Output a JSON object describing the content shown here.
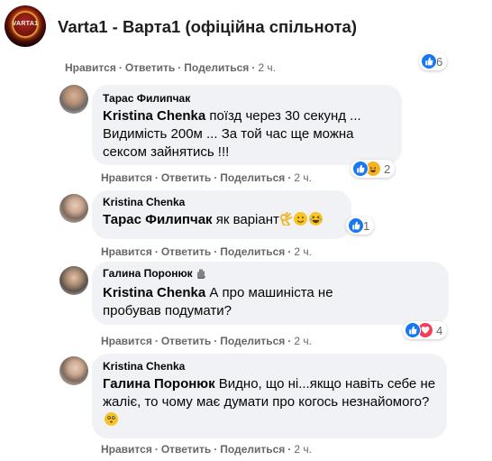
{
  "group": {
    "logo_text": "VARTA1",
    "title": "Varta1 - Варта1 (офіційна спільнота)"
  },
  "actions": {
    "like": "Нравится",
    "reply": "Ответить",
    "share": "Поделиться",
    "sep": "·"
  },
  "comments": [
    {
      "id": "top",
      "time": "2 ч.",
      "reactions": {
        "count": "6",
        "icons": [
          "like"
        ]
      }
    },
    {
      "id": "c1",
      "author": "Тарас Филипчак",
      "mention": "Kristina Chenka",
      "text": " поїзд через 30 секунд ... Видимість 200м ... За той час ще можна сексом зайнятись !!!",
      "time": "2 ч.",
      "reactions": {
        "count": "2",
        "icons": [
          "like",
          "haha"
        ]
      }
    },
    {
      "id": "c2",
      "author": "Kristina Chenka",
      "mention": "Тарас Филипчак",
      "text": " як варіант",
      "time": "2 ч.",
      "reactions": {
        "count": "1",
        "icons": [
          "like"
        ]
      }
    },
    {
      "id": "c3",
      "author": "Галина Поронюк",
      "mention": "Kristina Chenka",
      "text": " А про машиніста не пробував подумати?",
      "time": "2 ч.",
      "reactions": {
        "count": "4",
        "icons": [
          "like",
          "love"
        ]
      }
    },
    {
      "id": "c4",
      "author": "Kristina Chenka",
      "mention": "Галина Поронюк",
      "text": " Видно, що ні...якщо навіть себе не жаліє, то чому має думати про когось незнайомого?",
      "time": "2 ч."
    }
  ],
  "icons": {
    "like": "thumbs-up-icon",
    "haha": "laughing-face-icon",
    "love": "heart-icon",
    "ok_hand": "ok-hand-emoji-icon",
    "smile": "smiling-face-emoji-icon",
    "laugh": "laughing-face-emoji-icon",
    "wave": "waving-hand-icon",
    "flushed": "flushed-face-emoji-icon"
  },
  "colors": {
    "like": "#1877f2",
    "haha": "#f7b125",
    "love": "#f33e58",
    "bubble": "#f0f2f5",
    "meta": "#65676b"
  }
}
